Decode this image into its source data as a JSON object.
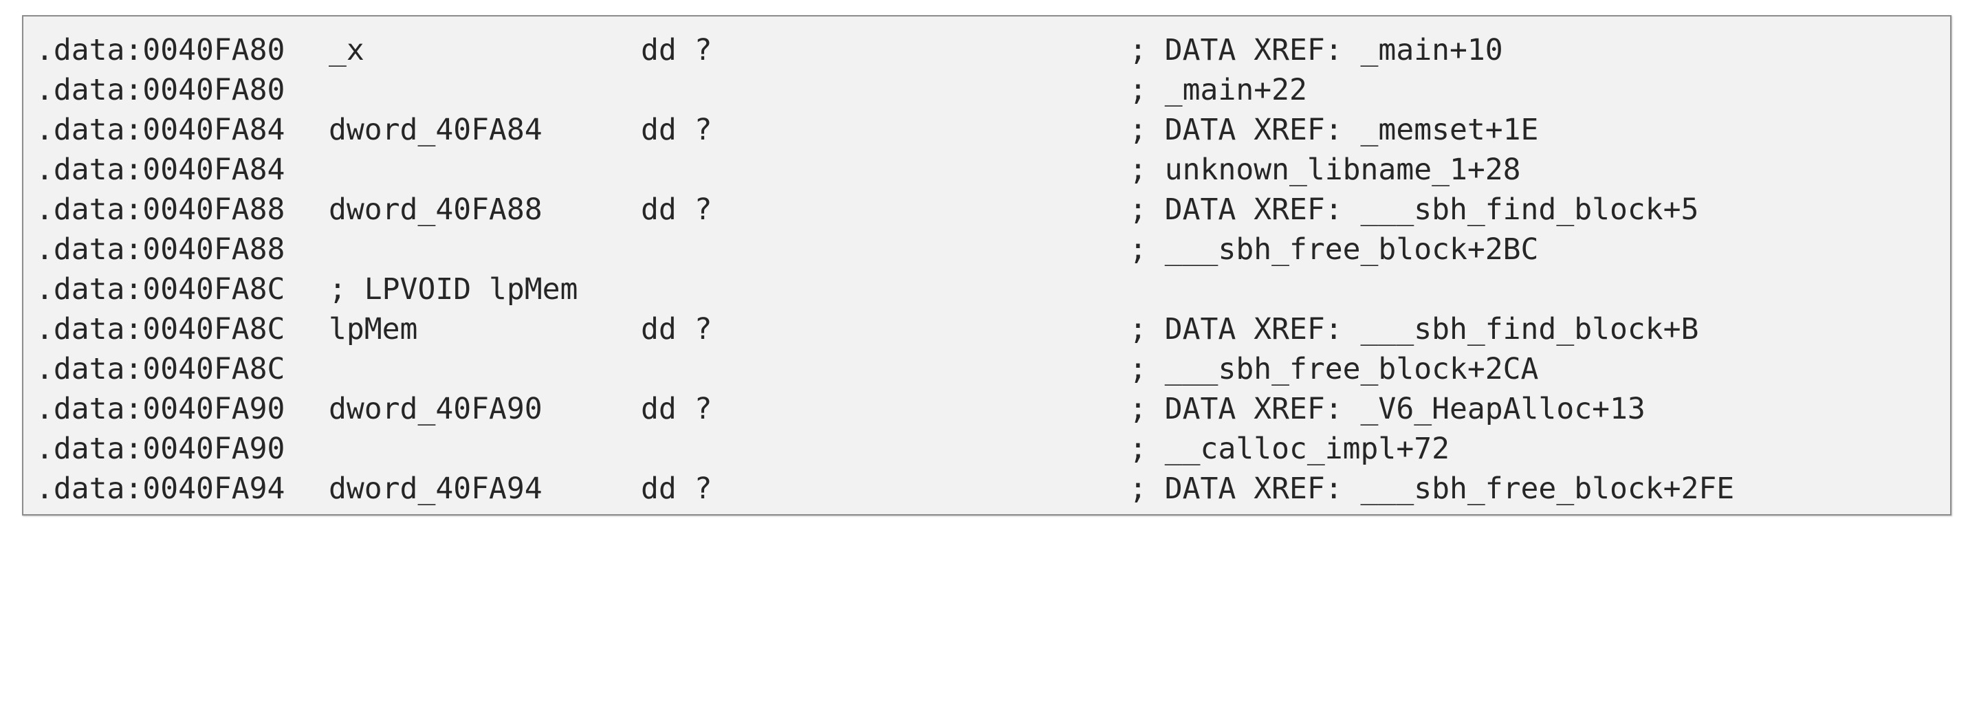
{
  "listing": {
    "lines": [
      {
        "addr": ".data:0040FA80",
        "name": "_x",
        "op": "dd ?",
        "comment": "; DATA XREF: _main+10"
      },
      {
        "addr": ".data:0040FA80",
        "name": "",
        "op": "",
        "comment": "; _main+22"
      },
      {
        "addr": ".data:0040FA84",
        "name": "dword_40FA84",
        "op": "dd ?",
        "comment": "; DATA XREF: _memset+1E"
      },
      {
        "addr": ".data:0040FA84",
        "name": "",
        "op": "",
        "comment": "; unknown_libname_1+28"
      },
      {
        "addr": ".data:0040FA88",
        "name": "dword_40FA88",
        "op": "dd ?",
        "comment": "; DATA XREF: ___sbh_find_block+5"
      },
      {
        "addr": ".data:0040FA88",
        "name": "",
        "op": "",
        "comment": "; ___sbh_free_block+2BC"
      },
      {
        "addr": ".data:0040FA8C",
        "name": "; LPVOID lpMem",
        "op": "",
        "comment": ""
      },
      {
        "addr": ".data:0040FA8C",
        "name": "lpMem",
        "op": "dd ?",
        "comment": "; DATA XREF: ___sbh_find_block+B"
      },
      {
        "addr": ".data:0040FA8C",
        "name": "",
        "op": "",
        "comment": "; ___sbh_free_block+2CA"
      },
      {
        "addr": ".data:0040FA90",
        "name": "dword_40FA90",
        "op": "dd ?",
        "comment": "; DATA XREF: _V6_HeapAlloc+13"
      },
      {
        "addr": ".data:0040FA90",
        "name": "",
        "op": "",
        "comment": "; __calloc_impl+72"
      },
      {
        "addr": ".data:0040FA94",
        "name": "dword_40FA94",
        "op": "dd ?",
        "comment": "; DATA XREF: ___sbh_free_block+2FE"
      }
    ]
  }
}
